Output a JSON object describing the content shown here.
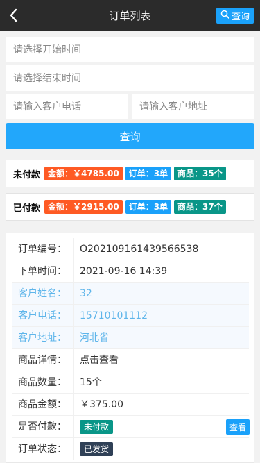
{
  "header": {
    "title": "订单列表",
    "query_label": "查询"
  },
  "filters": {
    "start_time_placeholder": "请选择开始时间",
    "end_time_placeholder": "请选择结束时间",
    "phone_placeholder": "请输入客户电话",
    "address_placeholder": "请输入客户地址",
    "query_button": "查询"
  },
  "summary": {
    "unpaid": {
      "label": "未付款",
      "amount": "金额：￥4785.00",
      "orders": "订单：3单",
      "goods": "商品：35个"
    },
    "paid": {
      "label": "已付款",
      "amount": "金额：￥2915.00",
      "orders": "订单：3单",
      "goods": "商品：37个"
    }
  },
  "order": {
    "no_label": "订单编号：",
    "no": "O202109161439566538",
    "time_label": "下单时间：",
    "time": "2021-09-16 14:39",
    "name_label": "客户姓名：",
    "name": "32",
    "phone_label": "客户电话：",
    "phone": "15710101112",
    "address_label": "客户地址：",
    "address": "河北省",
    "detail_label": "商品详情：",
    "detail": "点击查看",
    "qty_label": "商品数量：",
    "qty": "15个",
    "amount_label": "商品金额：",
    "amount": "￥375.00",
    "paid_label": "是否付款：",
    "paid_status": "未付款",
    "view_label": "查看",
    "status_label": "订单状态：",
    "status": "已发货"
  },
  "colors": {
    "header_bg": "#2b2b2b",
    "accent_blue": "#1aa1fa",
    "orange": "#fe5a24",
    "green": "#099688",
    "dark": "#2f4056"
  },
  "icons": {
    "back": "chevron-left-icon",
    "search": "search-icon"
  }
}
